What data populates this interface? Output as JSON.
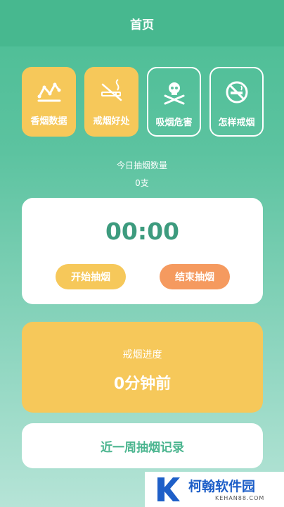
{
  "header": {
    "title": "首页"
  },
  "tiles": [
    {
      "label": "香烟数据",
      "icon": "chart-line-icon"
    },
    {
      "label": "戒烟好处",
      "icon": "no-smoking-cigarette-icon"
    },
    {
      "label": "吸烟危害",
      "icon": "skull-crossbones-icon"
    },
    {
      "label": "怎样戒烟",
      "icon": "no-smoking-sign-icon"
    }
  ],
  "today": {
    "label": "今日抽烟数量",
    "value": "0支"
  },
  "timer": {
    "value": "00:00",
    "start_label": "开始抽烟",
    "end_label": "结束抽烟"
  },
  "progress": {
    "label": "戒烟进度",
    "value": "0分钟前"
  },
  "record": {
    "label": "近一周抽烟记录"
  },
  "watermark": {
    "text": "柯翰软件园",
    "sub": "KEHAN88.COM"
  },
  "colors": {
    "primary": "#4bbd94",
    "yellow": "#f6c85a",
    "orange": "#f59a5f",
    "timer_text": "#3d9b7e"
  }
}
